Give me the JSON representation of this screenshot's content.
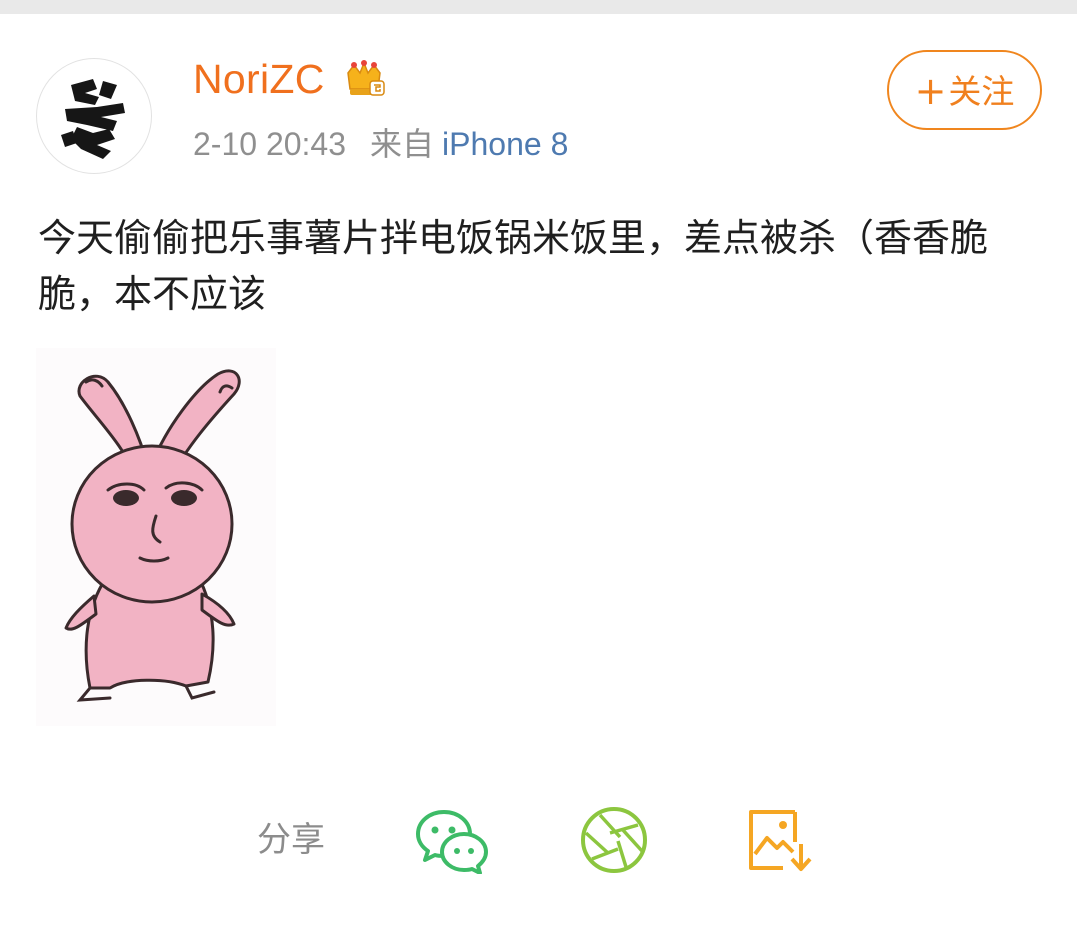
{
  "post": {
    "username": "NoriZC",
    "time": "2-10 20:43",
    "source_label": "来自",
    "device": "iPhone 8",
    "follow_plus": "+",
    "follow_label": "关注",
    "text": "今天偷偷把乐事薯片拌电饭锅米饭里，差点被杀（香香脆脆，本不应该"
  },
  "share": {
    "label": "分享",
    "icons": [
      "wechat-icon",
      "wechat-moments-icon",
      "save-image-icon"
    ]
  },
  "colors": {
    "username": "#f0701e",
    "follow_border": "#f0861e",
    "device_link": "#4e7ab0",
    "wechat_green": "#3dbb67",
    "moments_green": "#8cc63f",
    "save_orange": "#f5a623"
  }
}
